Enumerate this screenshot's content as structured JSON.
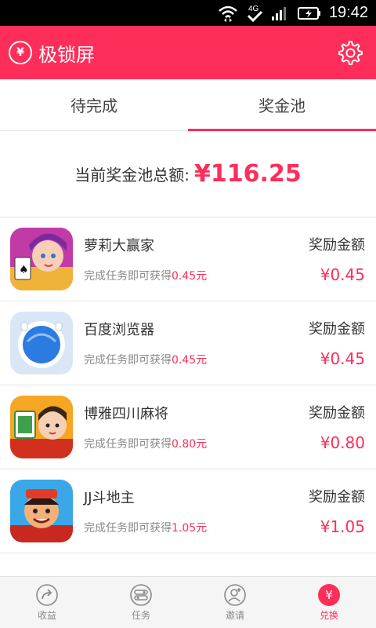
{
  "status_bar": {
    "time": "19:42",
    "network": "4G"
  },
  "app_bar": {
    "logo_symbol": "¥",
    "title": "极锁屏"
  },
  "tabs": [
    {
      "label": "待完成",
      "active": false
    },
    {
      "label": "奖金池",
      "active": true
    }
  ],
  "pool": {
    "label": "当前奖金池总额:",
    "amount": "¥116.25"
  },
  "tasks": [
    {
      "name": "萝莉大赢家",
      "desc_prefix": "完成任务即可获得",
      "desc_reward": "0.45元",
      "reward_label": "奖励金额",
      "reward_value": "¥0.45"
    },
    {
      "name": "百度浏览器",
      "desc_prefix": "完成任务即可获得",
      "desc_reward": "0.45元",
      "reward_label": "奖励金额",
      "reward_value": "¥0.45"
    },
    {
      "name": "博雅四川麻将",
      "desc_prefix": "完成任务即可获得",
      "desc_reward": "0.80元",
      "reward_label": "奖励金额",
      "reward_value": "¥0.80"
    },
    {
      "name": "JJ斗地主",
      "desc_prefix": "完成任务即可获得",
      "desc_reward": "1.05元",
      "reward_label": "奖励金额",
      "reward_value": "¥1.05"
    }
  ],
  "bottom_nav": [
    {
      "label": "收益",
      "icon": "share-arrow-icon",
      "active": false
    },
    {
      "label": "任务",
      "icon": "toggle-icon",
      "active": false
    },
    {
      "label": "邀请",
      "icon": "add-user-icon",
      "active": false
    },
    {
      "label": "兑换",
      "icon": "yuan-icon",
      "symbol": "¥",
      "active": true
    }
  ],
  "colors": {
    "accent": "#fe2d59",
    "status_bar": "#000000",
    "nav_bg": "#f5f5f5"
  }
}
